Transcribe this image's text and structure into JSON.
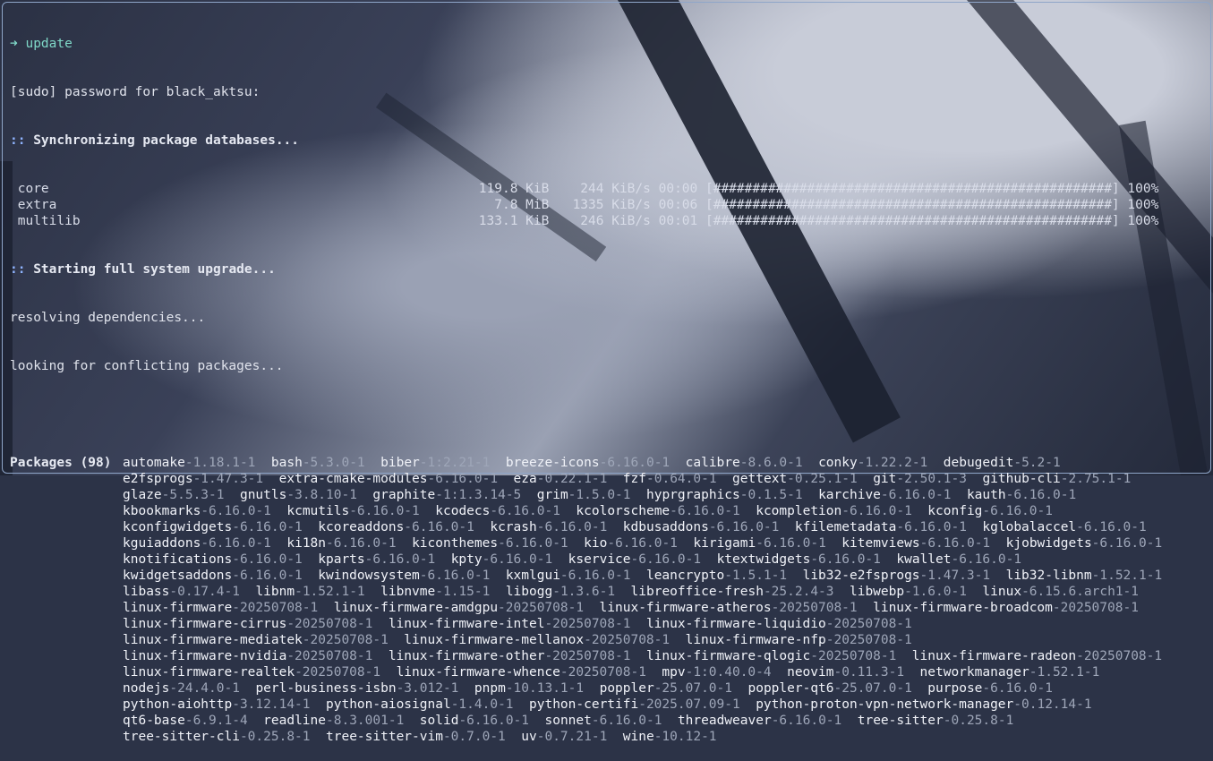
{
  "prompt": {
    "arrow": "➜",
    "command": "update"
  },
  "sudo_line": "[sudo] password for black_aktsu:",
  "sync_header": "Synchronizing package databases...",
  "header_marker": "::",
  "databases": [
    {
      "name": "core",
      "size": "119.8 KiB",
      "speed": "244 KiB/s",
      "time": "00:00",
      "bar": "[###################################################]",
      "pct": "100%"
    },
    {
      "name": "extra",
      "size": "7.8 MiB",
      "speed": "1335 KiB/s",
      "time": "00:06",
      "bar": "[###################################################]",
      "pct": "100%"
    },
    {
      "name": "multilib",
      "size": "133.1 KiB",
      "speed": "246 KiB/s",
      "time": "00:01",
      "bar": "[###################################################]",
      "pct": "100%"
    }
  ],
  "upgrade_header": "Starting full system upgrade...",
  "resolving": "resolving dependencies...",
  "conflicts": "looking for conflicting packages...",
  "packages_label": "Packages (98)",
  "package_rows": [
    [
      [
        "automake",
        "-1.18.1-1"
      ],
      [
        "bash",
        "-5.3.0-1"
      ],
      [
        "biber",
        "-1:2.21-1"
      ],
      [
        "breeze-icons",
        "-6.16.0-1"
      ],
      [
        "calibre",
        "-8.6.0-1"
      ],
      [
        "conky",
        "-1.22.2-1"
      ],
      [
        "debugedit",
        "-5.2-1"
      ]
    ],
    [
      [
        "e2fsprogs",
        "-1.47.3-1"
      ],
      [
        "extra-cmake-modules",
        "-6.16.0-1"
      ],
      [
        "eza",
        "-0.22.1-1"
      ],
      [
        "fzf",
        "-0.64.0-1"
      ],
      [
        "gettext",
        "-0.25.1-1"
      ],
      [
        "git",
        "-2.50.1-3"
      ],
      [
        "github-cli",
        "-2.75.1-1"
      ]
    ],
    [
      [
        "glaze",
        "-5.5.3-1"
      ],
      [
        "gnutls",
        "-3.8.10-1"
      ],
      [
        "graphite",
        "-1:1.3.14-5"
      ],
      [
        "grim",
        "-1.5.0-1"
      ],
      [
        "hyprgraphics",
        "-0.1.5-1"
      ],
      [
        "karchive",
        "-6.16.0-1"
      ],
      [
        "kauth",
        "-6.16.0-1"
      ]
    ],
    [
      [
        "kbookmarks",
        "-6.16.0-1"
      ],
      [
        "kcmutils",
        "-6.16.0-1"
      ],
      [
        "kcodecs",
        "-6.16.0-1"
      ],
      [
        "kcolorscheme",
        "-6.16.0-1"
      ],
      [
        "kcompletion",
        "-6.16.0-1"
      ],
      [
        "kconfig",
        "-6.16.0-1"
      ]
    ],
    [
      [
        "kconfigwidgets",
        "-6.16.0-1"
      ],
      [
        "kcoreaddons",
        "-6.16.0-1"
      ],
      [
        "kcrash",
        "-6.16.0-1"
      ],
      [
        "kdbusaddons",
        "-6.16.0-1"
      ],
      [
        "kfilemetadata",
        "-6.16.0-1"
      ],
      [
        "kglobalaccel",
        "-6.16.0-1"
      ]
    ],
    [
      [
        "kguiaddons",
        "-6.16.0-1"
      ],
      [
        "ki18n",
        "-6.16.0-1"
      ],
      [
        "kiconthemes",
        "-6.16.0-1"
      ],
      [
        "kio",
        "-6.16.0-1"
      ],
      [
        "kirigami",
        "-6.16.0-1"
      ],
      [
        "kitemviews",
        "-6.16.0-1"
      ],
      [
        "kjobwidgets",
        "-6.16.0-1"
      ]
    ],
    [
      [
        "knotifications",
        "-6.16.0-1"
      ],
      [
        "kparts",
        "-6.16.0-1"
      ],
      [
        "kpty",
        "-6.16.0-1"
      ],
      [
        "kservice",
        "-6.16.0-1"
      ],
      [
        "ktextwidgets",
        "-6.16.0-1"
      ],
      [
        "kwallet",
        "-6.16.0-1"
      ]
    ],
    [
      [
        "kwidgetsaddons",
        "-6.16.0-1"
      ],
      [
        "kwindowsystem",
        "-6.16.0-1"
      ],
      [
        "kxmlgui",
        "-6.16.0-1"
      ],
      [
        "leancrypto",
        "-1.5.1-1"
      ],
      [
        "lib32-e2fsprogs",
        "-1.47.3-1"
      ],
      [
        "lib32-libnm",
        "-1.52.1-1"
      ]
    ],
    [
      [
        "libass",
        "-0.17.4-1"
      ],
      [
        "libnm",
        "-1.52.1-1"
      ],
      [
        "libnvme",
        "-1.15-1"
      ],
      [
        "libogg",
        "-1.3.6-1"
      ],
      [
        "libreoffice-fresh",
        "-25.2.4-3"
      ],
      [
        "libwebp",
        "-1.6.0-1"
      ],
      [
        "linux",
        "-6.15.6.arch1-1"
      ]
    ],
    [
      [
        "linux-firmware",
        "-20250708-1"
      ],
      [
        "linux-firmware-amdgpu",
        "-20250708-1"
      ],
      [
        "linux-firmware-atheros",
        "-20250708-1"
      ],
      [
        "linux-firmware-broadcom",
        "-20250708-1"
      ]
    ],
    [
      [
        "linux-firmware-cirrus",
        "-20250708-1"
      ],
      [
        "linux-firmware-intel",
        "-20250708-1"
      ],
      [
        "linux-firmware-liquidio",
        "-20250708-1"
      ]
    ],
    [
      [
        "linux-firmware-mediatek",
        "-20250708-1"
      ],
      [
        "linux-firmware-mellanox",
        "-20250708-1"
      ],
      [
        "linux-firmware-nfp",
        "-20250708-1"
      ]
    ],
    [
      [
        "linux-firmware-nvidia",
        "-20250708-1"
      ],
      [
        "linux-firmware-other",
        "-20250708-1"
      ],
      [
        "linux-firmware-qlogic",
        "-20250708-1"
      ],
      [
        "linux-firmware-radeon",
        "-20250708-1"
      ]
    ],
    [
      [
        "linux-firmware-realtek",
        "-20250708-1"
      ],
      [
        "linux-firmware-whence",
        "-20250708-1"
      ],
      [
        "mpv",
        "-1:0.40.0-4"
      ],
      [
        "neovim",
        "-0.11.3-1"
      ],
      [
        "networkmanager",
        "-1.52.1-1"
      ]
    ],
    [
      [
        "nodejs",
        "-24.4.0-1"
      ],
      [
        "perl-business-isbn",
        "-3.012-1"
      ],
      [
        "pnpm",
        "-10.13.1-1"
      ],
      [
        "poppler",
        "-25.07.0-1"
      ],
      [
        "poppler-qt6",
        "-25.07.0-1"
      ],
      [
        "purpose",
        "-6.16.0-1"
      ]
    ],
    [
      [
        "python-aiohttp",
        "-3.12.14-1"
      ],
      [
        "python-aiosignal",
        "-1.4.0-1"
      ],
      [
        "python-certifi",
        "-2025.07.09-1"
      ],
      [
        "python-proton-vpn-network-manager",
        "-0.12.14-1"
      ]
    ],
    [
      [
        "qt6-base",
        "-6.9.1-4"
      ],
      [
        "readline",
        "-8.3.001-1"
      ],
      [
        "solid",
        "-6.16.0-1"
      ],
      [
        "sonnet",
        "-6.16.0-1"
      ],
      [
        "threadweaver",
        "-6.16.0-1"
      ],
      [
        "tree-sitter",
        "-0.25.8-1"
      ]
    ],
    [
      [
        "tree-sitter-cli",
        "-0.25.8-1"
      ],
      [
        "tree-sitter-vim",
        "-0.7.0-1"
      ],
      [
        "uv",
        "-0.7.21-1"
      ],
      [
        "wine",
        "-10.12-1"
      ]
    ]
  ]
}
